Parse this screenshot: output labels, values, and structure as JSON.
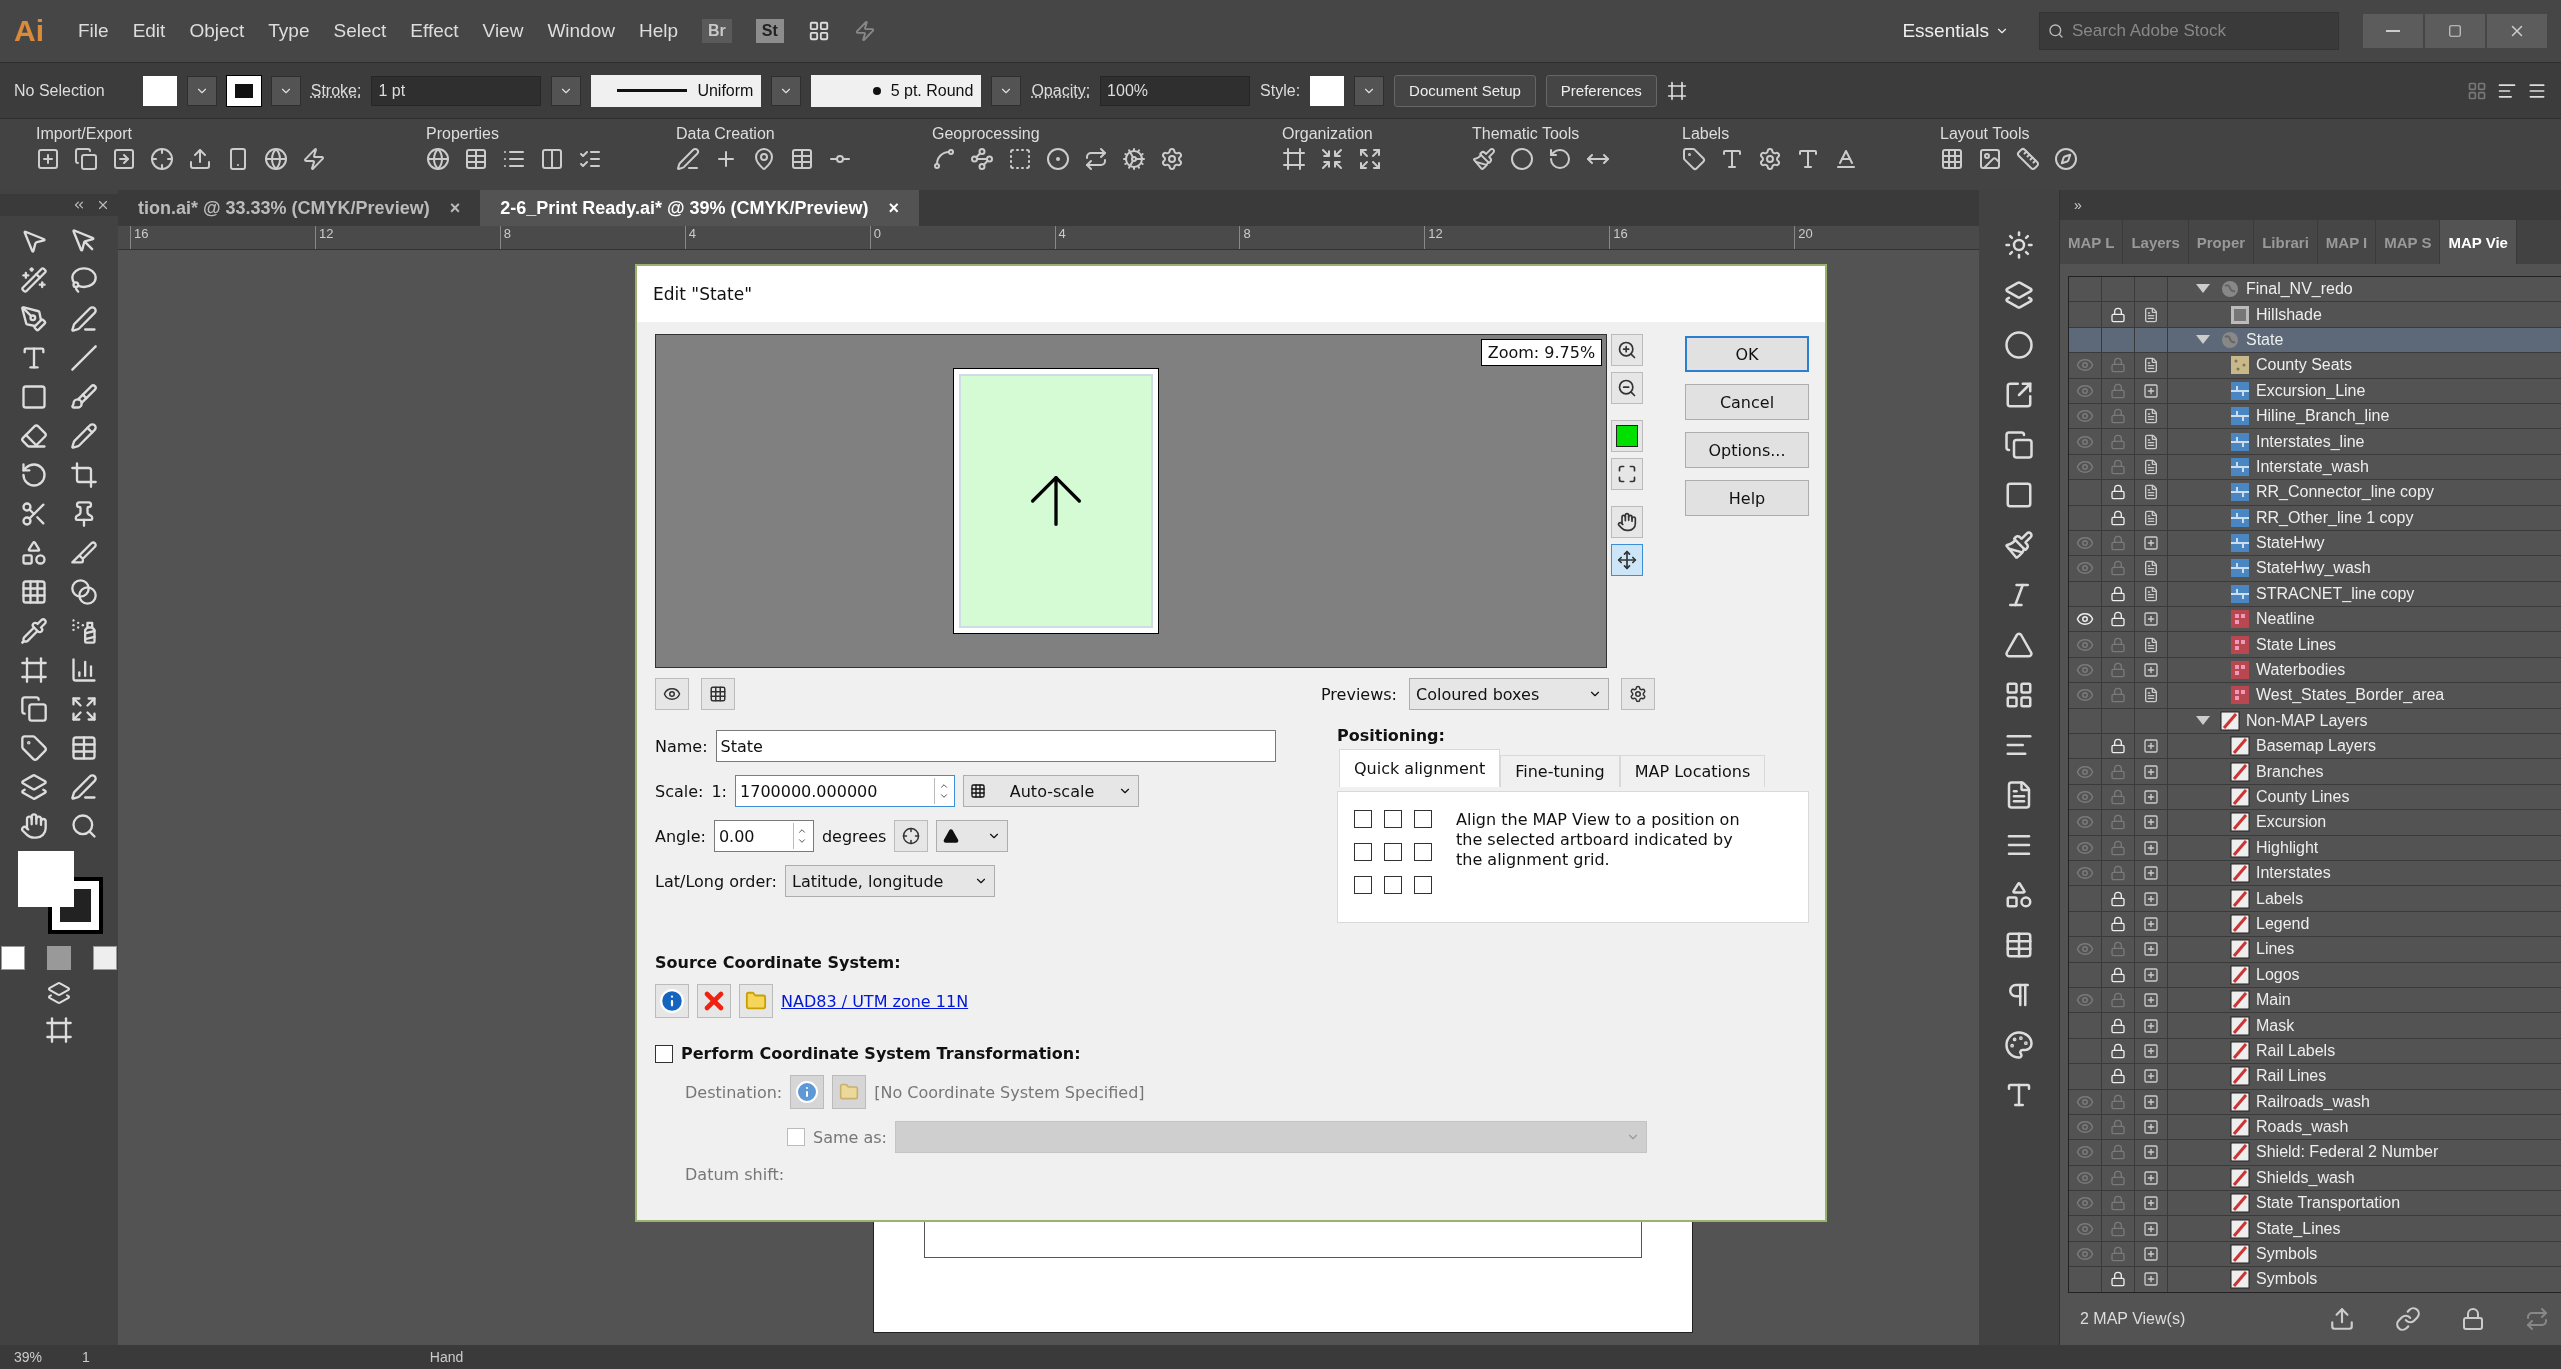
{
  "menu_bar": {
    "logo": "Ai",
    "items": [
      "File",
      "Edit",
      "Object",
      "Type",
      "Select",
      "Effect",
      "View",
      "Window",
      "Help"
    ],
    "bridge": "Br",
    "stock": "St",
    "workspace": "Essentials",
    "search": {
      "placeholder": "Search Adobe Stock"
    }
  },
  "control_bar": {
    "selection": "No Selection",
    "stroke_label": "Stroke:",
    "stroke_weight": "1 pt",
    "profile": "Uniform",
    "brush": "5 pt. Round",
    "opacity_label": "Opacity:",
    "opacity": "100%",
    "style_label": "Style:",
    "buttons": [
      "Document Setup",
      "Preferences"
    ]
  },
  "plugin_toolbar": {
    "groups": [
      "Import/Export",
      "Properties",
      "Data Creation",
      "Geoprocessing",
      "Organization",
      "Thematic Tools",
      "Labels",
      "Layout Tools"
    ]
  },
  "document_tabs": [
    {
      "label": "tion.ai* @ 33.33% (CMYK/Preview)",
      "close": "×",
      "selected": false
    },
    {
      "label": "2-6_Print Ready.ai* @ 39% (CMYK/Preview)",
      "close": "×",
      "selected": true
    }
  ],
  "ruler": {
    "ticks": [
      "16",
      "12",
      "8",
      "4",
      "0",
      "4",
      "8",
      "12",
      "16",
      "20"
    ]
  },
  "dialog": {
    "title": "Edit \"State\"",
    "zoom": "Zoom: 9.75%",
    "preview_tools": [
      {
        "kind": "zoom-in",
        "selected": false
      },
      {
        "kind": "zoom-out",
        "selected": false
      },
      {
        "kind": "color",
        "selected": false
      },
      {
        "kind": "fit",
        "selected": false
      },
      {
        "kind": "hand",
        "selected": false
      },
      {
        "kind": "move",
        "selected": true
      }
    ],
    "buttons": [
      {
        "label": "OK",
        "default": true
      },
      {
        "label": "Cancel",
        "default": false
      },
      {
        "label": "Options...",
        "default": false
      },
      {
        "label": "Help",
        "default": false
      }
    ],
    "previews_label": "Previews:",
    "previews_value": "Coloured boxes",
    "name_label": "Name:",
    "name_value": "State",
    "scale_label": "Scale:",
    "scale_prefix": "1:",
    "scale_value": "1700000.000000",
    "autoscale": "Auto-scale",
    "angle_label": "Angle:",
    "angle_value": "0.00",
    "angle_unit": "degrees",
    "latlong_label": "Lat/Long order:",
    "latlong_value": "Latitude, longitude",
    "positioning_label": "Positioning:",
    "positioning_tabs": [
      {
        "label": "Quick alignment",
        "selected": true
      },
      {
        "label": "Fine-tuning",
        "selected": false
      },
      {
        "label": "MAP Locations",
        "selected": false
      }
    ],
    "alignment_grid": [
      {
        "checked": false
      },
      {
        "checked": false
      },
      {
        "checked": false
      },
      {
        "checked": false
      },
      {
        "checked": false
      },
      {
        "checked": false
      },
      {
        "checked": false
      },
      {
        "checked": false
      },
      {
        "checked": false
      }
    ],
    "alignment_text": "Align the MAP View to a position on the selected artboard indicated by the alignment grid.",
    "source_label": "Source Coordinate System:",
    "source_link": "NAD83 / UTM zone 11N",
    "transform_label": "Perform Coordinate System Transformation:",
    "transform_checked": false,
    "destination_label": "Destination:",
    "destination_value": "[No Coordinate System Specified]",
    "same_as_label": "Same as:",
    "same_as_checked": false,
    "datum_label": "Datum shift:"
  },
  "layers_panel": {
    "collapse": "»",
    "tabs": [
      {
        "label": "MAP L",
        "selected": false
      },
      {
        "label": "Layers",
        "selected": false
      },
      {
        "label": "Proper",
        "selected": false
      },
      {
        "label": "Librari",
        "selected": false
      },
      {
        "label": "MAP I",
        "selected": false
      },
      {
        "label": "MAP S",
        "selected": false
      },
      {
        "label": "MAP Vie",
        "selected": true
      }
    ],
    "tree": [
      {
        "name": "Final_NV_redo",
        "kind": "map",
        "selected": false,
        "expanded": true,
        "children": [
          {
            "name": "Hillshade",
            "kind": "raster",
            "locked": true,
            "expandable": false,
            "selected": false
          }
        ]
      },
      {
        "name": "State",
        "kind": "map",
        "selected": true,
        "expanded": true,
        "children": [
          {
            "name": "County Seats",
            "kind": "point",
            "visible": false,
            "locked": false,
            "expandable": false,
            "selected": false
          },
          {
            "name": "Excursion_Line",
            "kind": "line",
            "visible": false,
            "locked": false,
            "expandable": true,
            "selected": false
          },
          {
            "name": "Hiline_Branch_line",
            "kind": "line",
            "visible": false,
            "locked": false,
            "expandable": false,
            "selected": false
          },
          {
            "name": "Interstates_line",
            "kind": "line",
            "visible": false,
            "locked": false,
            "expandable": false,
            "selected": false
          },
          {
            "name": "Interstate_wash",
            "kind": "line",
            "visible": false,
            "locked": false,
            "expandable": false,
            "selected": false
          },
          {
            "name": "RR_Connector_line copy",
            "kind": "line",
            "locked": true,
            "expandable": false,
            "selected": false
          },
          {
            "name": "RR_Other_line 1 copy",
            "kind": "line",
            "locked": true,
            "expandable": false,
            "selected": false
          },
          {
            "name": "StateHwy",
            "kind": "line",
            "visible": false,
            "locked": false,
            "expandable": true,
            "selected": false
          },
          {
            "name": "StateHwy_wash",
            "kind": "line",
            "visible": false,
            "locked": false,
            "expandable": false,
            "selected": false
          },
          {
            "name": "STRACNET_line copy",
            "kind": "line",
            "locked": true,
            "expandable": false,
            "selected": false
          },
          {
            "name": "Neatline",
            "kind": "area",
            "visible": true,
            "locked": true,
            "expandable": true,
            "selected": false
          },
          {
            "name": "State Lines",
            "kind": "area",
            "visible": false,
            "locked": false,
            "expandable": false,
            "selected": false
          },
          {
            "name": "Waterbodies",
            "kind": "area",
            "visible": false,
            "locked": false,
            "expandable": true,
            "selected": false
          },
          {
            "name": "West_States_Border_area",
            "kind": "area",
            "visible": false,
            "locked": false,
            "expandable": false,
            "selected": false
          }
        ]
      },
      {
        "name": "Non-MAP Layers",
        "kind": "nonmap",
        "selected": false,
        "expanded": true,
        "children": [
          {
            "name": "Basemap Layers",
            "kind": "nonmap",
            "locked": true,
            "expandable": true,
            "selected": false
          },
          {
            "name": "Branches",
            "kind": "nonmap",
            "visible": false,
            "locked": false,
            "expandable": true,
            "selected": false
          },
          {
            "name": "County Lines",
            "kind": "nonmap",
            "visible": false,
            "locked": false,
            "expandable": true,
            "selected": false
          },
          {
            "name": "Excursion",
            "kind": "nonmap",
            "visible": false,
            "locked": false,
            "expandable": true,
            "selected": false
          },
          {
            "name": "Highlight",
            "kind": "nonmap",
            "visible": false,
            "locked": false,
            "expandable": true,
            "selected": false
          },
          {
            "name": "Interstates",
            "kind": "nonmap",
            "visible": false,
            "locked": false,
            "expandable": true,
            "selected": false
          },
          {
            "name": "Labels",
            "kind": "nonmap",
            "locked": true,
            "expandable": true,
            "selected": false
          },
          {
            "name": "Legend",
            "kind": "nonmap",
            "locked": true,
            "expandable": true,
            "selected": false
          },
          {
            "name": "Lines",
            "kind": "nonmap",
            "visible": false,
            "locked": false,
            "expandable": true,
            "selected": false
          },
          {
            "name": "Logos",
            "kind": "nonmap",
            "locked": true,
            "expandable": true,
            "selected": false
          },
          {
            "name": "Main",
            "kind": "nonmap",
            "visible": false,
            "locked": false,
            "expandable": true,
            "selected": false
          },
          {
            "name": "Mask",
            "kind": "nonmap",
            "locked": true,
            "expandable": true,
            "selected": false
          },
          {
            "name": "Rail Labels",
            "kind": "nonmap",
            "locked": true,
            "expandable": true,
            "selected": false
          },
          {
            "name": "Rail Lines",
            "kind": "nonmap",
            "locked": true,
            "expandable": true,
            "selected": false
          },
          {
            "name": "Railroads_wash",
            "kind": "nonmap",
            "visible": false,
            "locked": false,
            "expandable": true,
            "selected": false
          },
          {
            "name": "Roads_wash",
            "kind": "nonmap",
            "visible": false,
            "locked": false,
            "expandable": true,
            "selected": false
          },
          {
            "name": "Shield: Federal 2 Number",
            "kind": "nonmap",
            "visible": false,
            "locked": false,
            "expandable": true,
            "selected": false
          },
          {
            "name": "Shields_wash",
            "kind": "nonmap",
            "visible": false,
            "locked": false,
            "expandable": true,
            "selected": false
          },
          {
            "name": "State Transportation",
            "kind": "nonmap",
            "visible": false,
            "locked": false,
            "expandable": true,
            "selected": false
          },
          {
            "name": "State_Lines",
            "kind": "nonmap",
            "visible": false,
            "locked": false,
            "expandable": true,
            "selected": false
          },
          {
            "name": "Symbols",
            "kind": "nonmap",
            "visible": false,
            "locked": false,
            "expandable": true,
            "selected": false
          },
          {
            "name": "Symbols",
            "kind": "nonmap",
            "locked": true,
            "expandable": true,
            "selected": false
          }
        ]
      }
    ],
    "footer": "2 MAP View(s)"
  },
  "status_bar": {
    "zoom": "39%",
    "artboard": "1",
    "tool": "Hand"
  }
}
